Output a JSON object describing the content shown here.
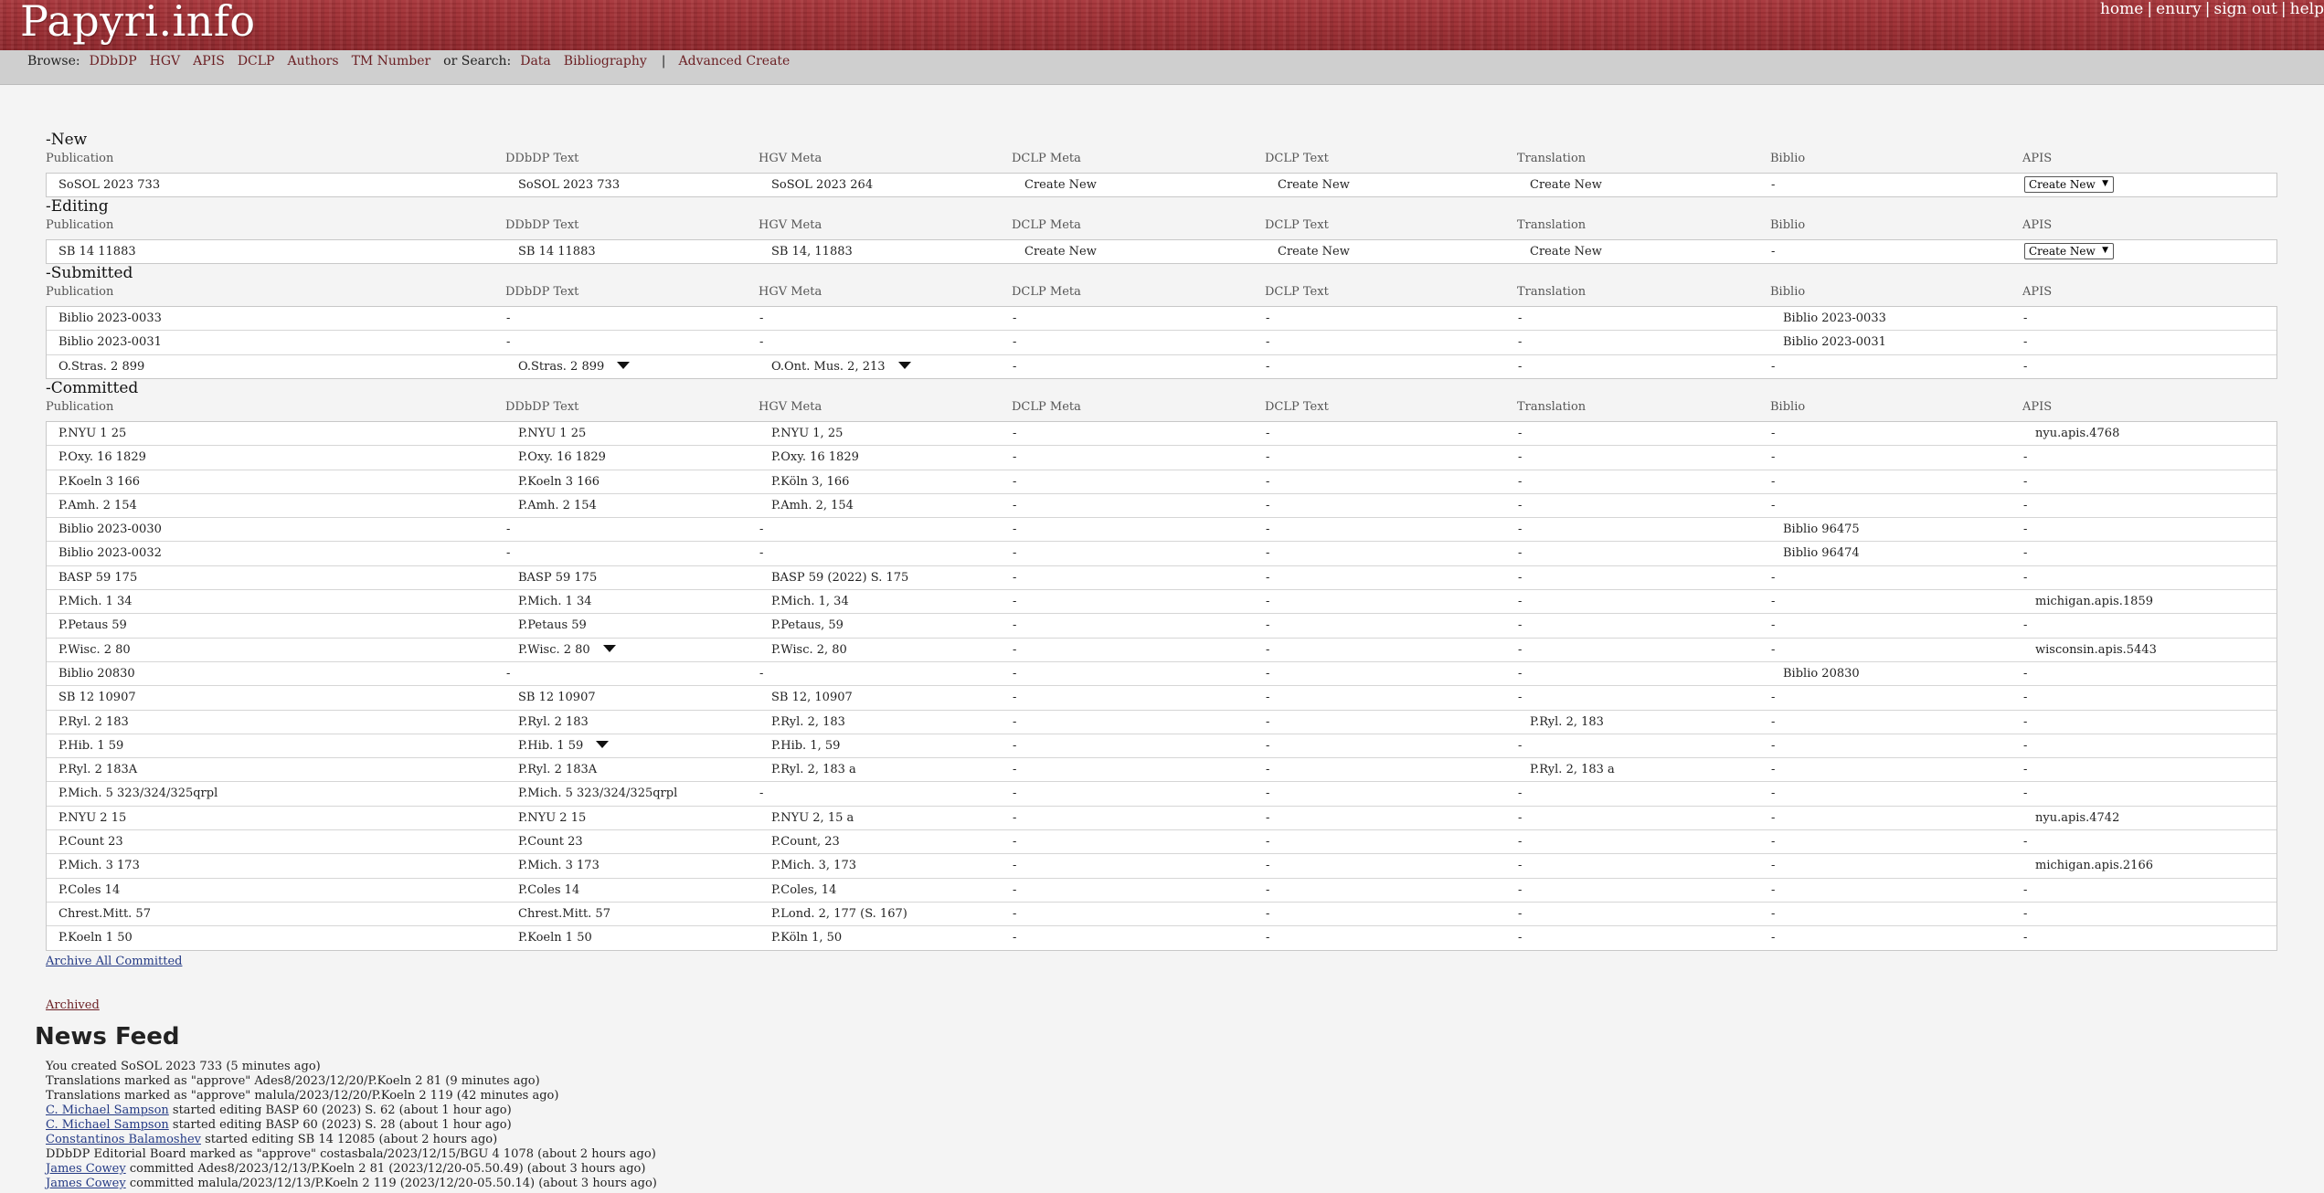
{
  "site": {
    "logo": "Papyri.info"
  },
  "userlinks": [
    "home",
    "enury",
    "sign out",
    "help"
  ],
  "nav": {
    "browse_label": "Browse:",
    "browse": [
      "DDbDP",
      "HGV",
      "APIS",
      "DCLP",
      "Authors",
      "TM Number"
    ],
    "search_label": "or Search:",
    "search": [
      "Data",
      "Bibliography"
    ],
    "separator": "|",
    "advanced": "Advanced Create"
  },
  "columns": [
    "Publication",
    "DDbDP Text",
    "HGV Meta",
    "DCLP Meta",
    "DCLP Text",
    "Translation",
    "Biblio",
    "APIS"
  ],
  "sections": [
    {
      "title": "-New",
      "rows": [
        {
          "cells": [
            "SoSOL 2023 733",
            "SoSOL 2023 733",
            "SoSOL 2023 264",
            "Create New",
            "Create New",
            "Create New",
            "-",
            {
              "select": "Create New"
            }
          ]
        }
      ]
    },
    {
      "title": "-Editing",
      "rows": [
        {
          "cells": [
            "SB 14 11883",
            "SB 14 11883",
            "SB 14, 11883",
            "Create New",
            "Create New",
            "Create New",
            "-",
            {
              "select": "Create New"
            }
          ]
        }
      ]
    },
    {
      "title": "-Submitted",
      "rows": [
        {
          "cells": [
            "Biblio 2023-0033",
            "-",
            "-",
            "-",
            "-",
            "-",
            "Biblio 2023-0033",
            "-"
          ]
        },
        {
          "cells": [
            "Biblio 2023-0031",
            "-",
            "-",
            "-",
            "-",
            "-",
            "Biblio 2023-0031",
            "-"
          ]
        },
        {
          "cells": [
            "O.Stras. 2 899",
            "O.Stras. 2 899",
            "O.Ont. Mus. 2, 213",
            "-",
            "-",
            "-",
            "-",
            "-"
          ],
          "tri": [
            1,
            2
          ]
        }
      ]
    },
    {
      "title": "-Committed",
      "rows": [
        {
          "cells": [
            "P.NYU 1 25",
            "P.NYU 1 25",
            "P.NYU 1, 25",
            "-",
            "-",
            "-",
            "-",
            "nyu.apis.4768"
          ]
        },
        {
          "cells": [
            "P.Oxy. 16 1829",
            "P.Oxy. 16 1829",
            "P.Oxy. 16 1829",
            "-",
            "-",
            "-",
            "-",
            "-"
          ]
        },
        {
          "cells": [
            "P.Koeln 3 166",
            "P.Koeln 3 166",
            "P.Köln 3, 166",
            "-",
            "-",
            "-",
            "-",
            "-"
          ]
        },
        {
          "cells": [
            "P.Amh. 2 154",
            "P.Amh. 2 154",
            "P.Amh. 2, 154",
            "-",
            "-",
            "-",
            "-",
            "-"
          ]
        },
        {
          "cells": [
            "Biblio 2023-0030",
            "-",
            "-",
            "-",
            "-",
            "-",
            "Biblio 96475",
            "-"
          ]
        },
        {
          "cells": [
            "Biblio 2023-0032",
            "-",
            "-",
            "-",
            "-",
            "-",
            "Biblio 96474",
            "-"
          ]
        },
        {
          "cells": [
            "BASP 59 175",
            "BASP 59 175",
            "BASP 59 (2022) S. 175",
            "-",
            "-",
            "-",
            "-",
            "-"
          ]
        },
        {
          "cells": [
            "P.Mich. 1 34",
            "P.Mich. 1 34",
            "P.Mich. 1, 34",
            "-",
            "-",
            "-",
            "-",
            "michigan.apis.1859"
          ]
        },
        {
          "cells": [
            "P.Petaus 59",
            "P.Petaus 59",
            "P.Petaus, 59",
            "-",
            "-",
            "-",
            "-",
            "-"
          ]
        },
        {
          "cells": [
            "P.Wisc. 2 80",
            "P.Wisc. 2 80",
            "P.Wisc. 2, 80",
            "-",
            "-",
            "-",
            "-",
            "wisconsin.apis.5443"
          ],
          "tri": [
            1
          ]
        },
        {
          "cells": [
            "Biblio 20830",
            "-",
            "-",
            "-",
            "-",
            "-",
            "Biblio 20830",
            "-"
          ]
        },
        {
          "cells": [
            "SB 12 10907",
            "SB 12 10907",
            "SB 12, 10907",
            "-",
            "-",
            "-",
            "-",
            "-"
          ]
        },
        {
          "cells": [
            "P.Ryl. 2 183",
            "P.Ryl. 2 183",
            "P.Ryl. 2, 183",
            "-",
            "-",
            "P.Ryl. 2, 183",
            "-",
            "-"
          ]
        },
        {
          "cells": [
            "P.Hib. 1 59",
            "P.Hib. 1 59",
            "P.Hib. 1, 59",
            "-",
            "-",
            "-",
            "-",
            "-"
          ],
          "tri": [
            1
          ]
        },
        {
          "cells": [
            "P.Ryl. 2 183A",
            "P.Ryl. 2 183A",
            "P.Ryl. 2, 183 a",
            "-",
            "-",
            "P.Ryl. 2, 183 a",
            "-",
            "-"
          ]
        },
        {
          "cells": [
            "P.Mich. 5 323/324/325qrpl",
            "P.Mich. 5 323/324/325qrpl",
            "-",
            "-",
            "-",
            "-",
            "-",
            "-"
          ]
        },
        {
          "cells": [
            "P.NYU 2 15",
            "P.NYU 2 15",
            "P.NYU 2, 15 a",
            "-",
            "-",
            "-",
            "-",
            "nyu.apis.4742"
          ]
        },
        {
          "cells": [
            "P.Count 23",
            "P.Count 23",
            "P.Count, 23",
            "-",
            "-",
            "-",
            "-",
            "-"
          ]
        },
        {
          "cells": [
            "P.Mich. 3 173",
            "P.Mich. 3 173",
            "P.Mich. 3, 173",
            "-",
            "-",
            "-",
            "-",
            "michigan.apis.2166"
          ]
        },
        {
          "cells": [
            "P.Coles 14",
            "P.Coles 14",
            "P.Coles, 14",
            "-",
            "-",
            "-",
            "-",
            "-"
          ]
        },
        {
          "cells": [
            "Chrest.Mitt. 57",
            "Chrest.Mitt. 57",
            "P.Lond. 2, 177 (S. 167)",
            "-",
            "-",
            "-",
            "-",
            "-"
          ]
        },
        {
          "cells": [
            "P.Koeln 1 50",
            "P.Koeln 1 50",
            "P.Köln 1, 50",
            "-",
            "-",
            "-",
            "-",
            "-"
          ]
        }
      ]
    }
  ],
  "archive_all": "Archive All Committed",
  "archived": "Archived",
  "news": {
    "title": "News Feed",
    "items": [
      {
        "user": "",
        "text": "You created SoSOL 2023 733 (5 minutes ago)"
      },
      {
        "user": "",
        "text": "Translations marked as \"approve\" Ades8/2023/12/20/P.Koeln 2 81 (9 minutes ago)"
      },
      {
        "user": "",
        "text": "Translations marked as \"approve\" malula/2023/12/20/P.Koeln 2 119 (42 minutes ago)"
      },
      {
        "user": "C. Michael Sampson",
        "text": " started editing BASP 60 (2023) S. 62 (about 1 hour ago)"
      },
      {
        "user": "C. Michael Sampson",
        "text": " started editing BASP 60 (2023) S. 28 (about 1 hour ago)"
      },
      {
        "user": "Constantinos Balamoshev",
        "text": " started editing SB 14 12085 (about 2 hours ago)"
      },
      {
        "user": "",
        "text": "DDbDP Editorial Board marked as \"approve\" costasbala/2023/12/15/BGU 4 1078 (about 2 hours ago)"
      },
      {
        "user": "James Cowey",
        "text": " committed Ades8/2023/12/13/P.Koeln 2 81 (2023/12/20-05.50.49) (about 3 hours ago)"
      },
      {
        "user": "James Cowey",
        "text": " committed malula/2023/12/13/P.Koeln 2 119 (2023/12/20-05.50.14) (about 3 hours ago)"
      }
    ]
  }
}
